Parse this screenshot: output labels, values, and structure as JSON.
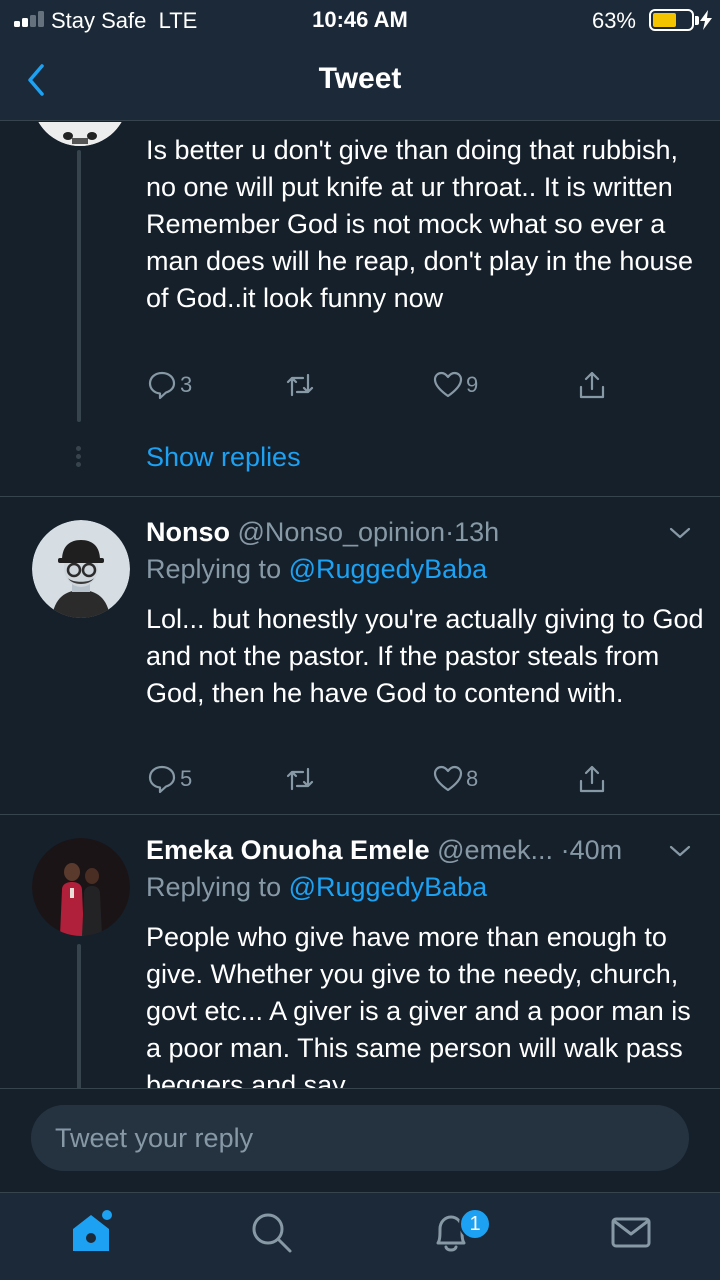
{
  "status_bar": {
    "carrier": "Stay Safe",
    "network": "LTE",
    "time": "10:46 AM",
    "battery_percent": "63%",
    "battery_level": 0.63
  },
  "header": {
    "title": "Tweet",
    "back_icon": "chevron-left-icon"
  },
  "tweets": [
    {
      "text": "Is better u don't give than doing that rubbish, no one will put knife at ur throat.. It is written Remember God is not mock what so ever a man does will he reap, don't play in the house of God..it look funny now",
      "replies": "3",
      "likes": "9",
      "show_replies": "Show replies"
    },
    {
      "name": "Nonso",
      "handle": "@Nonso_opinion",
      "separator": "·",
      "time": "13h",
      "replying_to_label": "Replying to",
      "replying_to": "@RuggedyBaba",
      "text": "Lol... but honestly you're actually giving to God and not the pastor. If the pastor steals from God, then he have God to contend with.",
      "replies": "5",
      "likes": "8"
    },
    {
      "name": "Emeka Onuoha Emele",
      "handle": "@emek...",
      "separator": "·",
      "time": "40m",
      "replying_to_label": "Replying to",
      "replying_to": "@RuggedyBaba",
      "text": "People who give have more than enough to give. Whether you give to the needy, church, govt etc... A giver is a giver and a poor man is a poor man. This same person will walk pass beggers and say"
    }
  ],
  "composer": {
    "placeholder": "Tweet your reply"
  },
  "tab_bar": {
    "items": [
      "home-icon",
      "search-icon",
      "notifications-icon",
      "messages-icon"
    ],
    "notification_badge": "1"
  },
  "colors": {
    "background": "#15202b",
    "bar": "#1c2938",
    "accent": "#1da1f2",
    "muted": "#8899a6",
    "divider": "#38444d",
    "battery": "#f5c400"
  }
}
